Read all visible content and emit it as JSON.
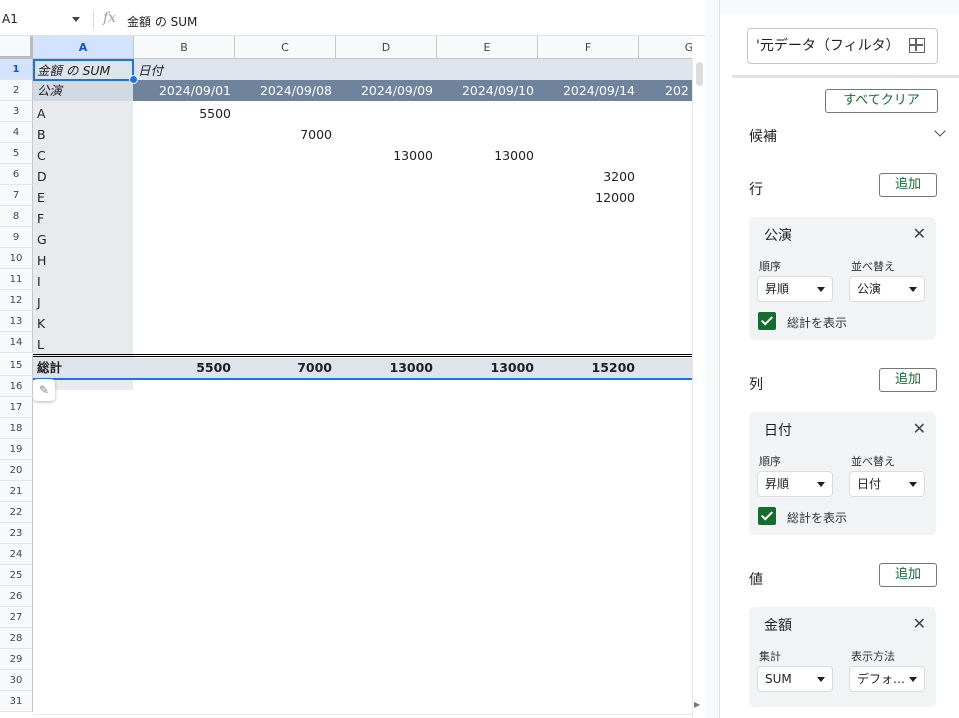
{
  "formula_bar": {
    "name_box": "A1",
    "fx": "fx",
    "value": "金額 の SUM"
  },
  "grid": {
    "columns": [
      "A",
      "B",
      "C",
      "D",
      "E",
      "F",
      "G"
    ],
    "rows": [
      "1",
      "2",
      "3",
      "4",
      "5",
      "6",
      "7",
      "8",
      "9",
      "10",
      "11",
      "12",
      "13",
      "14",
      "15",
      "16",
      "17",
      "18",
      "19",
      "20",
      "21",
      "22",
      "23",
      "24",
      "25",
      "26",
      "27",
      "28",
      "29",
      "30",
      "31"
    ],
    "a1": "金額 の SUM",
    "b1": "日付",
    "a2": "公演",
    "dates": [
      "2024/09/01",
      "2024/09/08",
      "2024/09/09",
      "2024/09/10",
      "2024/09/14",
      "202"
    ],
    "row_labels": [
      "A",
      "B",
      "C",
      "D",
      "E",
      "F",
      "G",
      "H",
      "I",
      "J",
      "K",
      "L"
    ],
    "values": {
      "b3": "5500",
      "c4": "7000",
      "d5": "13000",
      "e5": "13000",
      "f6": "3200",
      "f7": "12000"
    },
    "total_label": "総計",
    "totals": [
      "5500",
      "7000",
      "13000",
      "13000",
      "15200"
    ]
  },
  "editor": {
    "range": "'元データ（フィルタ）",
    "clear_all": "すべてクリア",
    "suggestions": "候補",
    "rows_label": "行",
    "columns_label": "列",
    "values_label": "値",
    "add": "追加",
    "row_card": {
      "title": "公演",
      "order_label": "順序",
      "order_value": "昇順",
      "sort_label": "並べ替え",
      "sort_value": "公演",
      "show_totals": "総計を表示"
    },
    "col_card": {
      "title": "日付",
      "order_label": "順序",
      "order_value": "昇順",
      "sort_label": "並べ替え",
      "sort_value": "日付",
      "show_totals": "総計を表示"
    },
    "value_card": {
      "title": "金額",
      "agg_label": "集計",
      "agg_value": "SUM",
      "show_as_label": "表示方法",
      "show_as_value": "デフォ…"
    }
  }
}
